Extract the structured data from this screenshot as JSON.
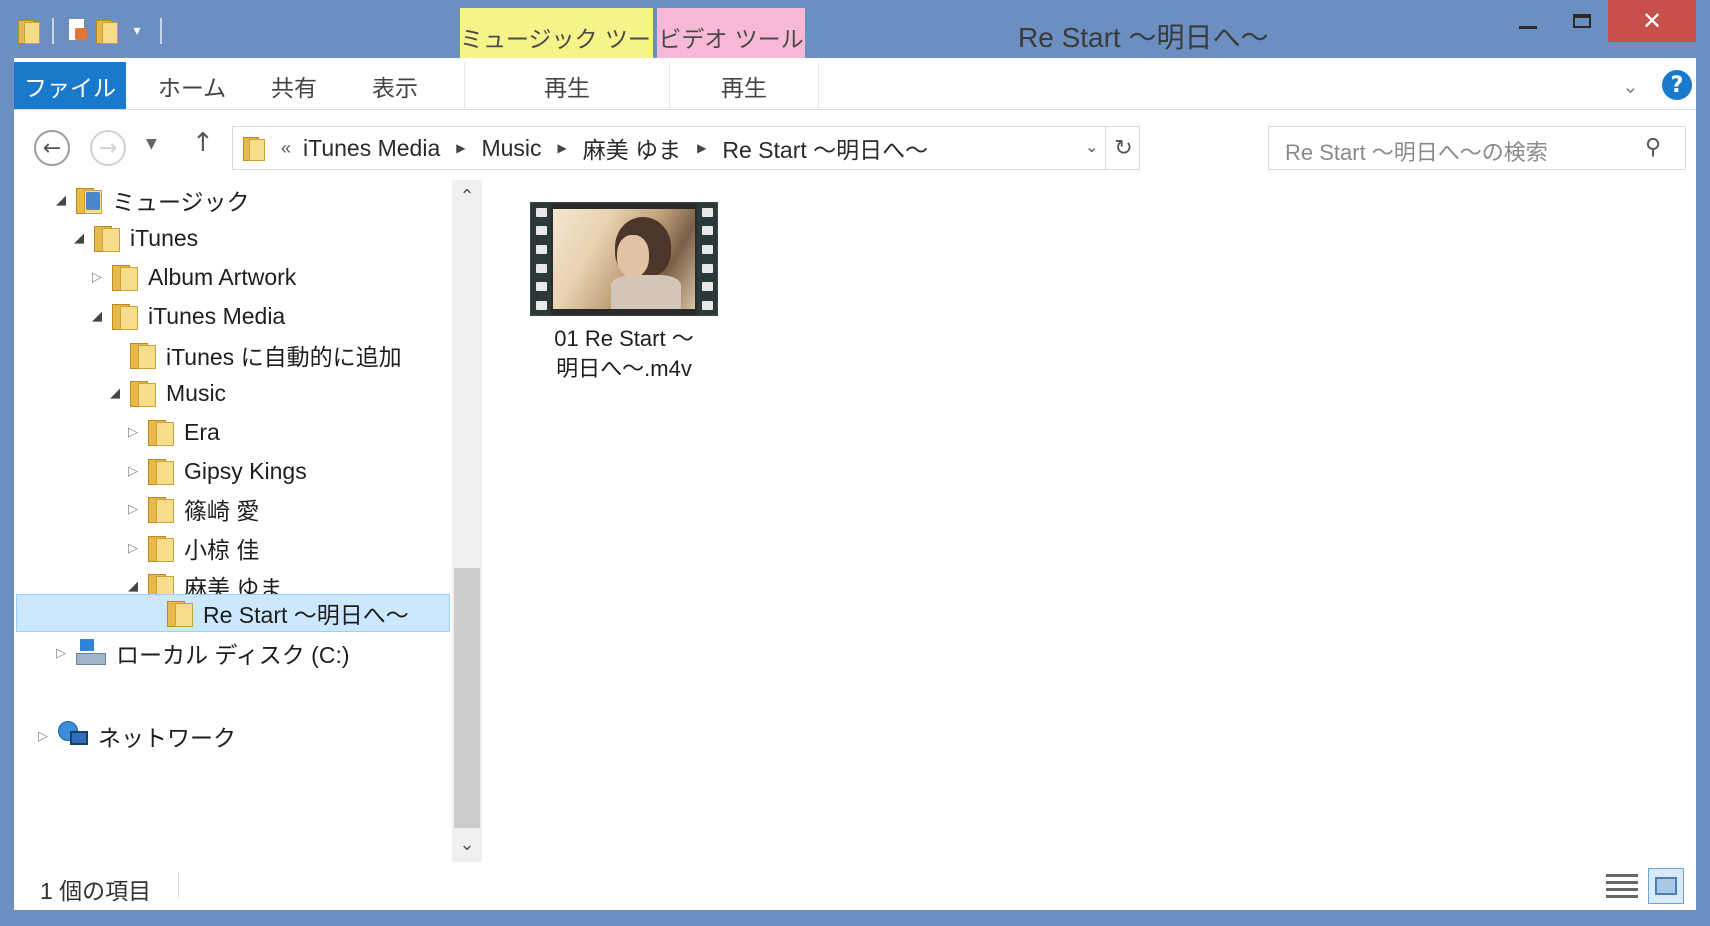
{
  "window": {
    "title": "Re Start ～明日へ～",
    "close_glyph": "✕"
  },
  "context_tabs": {
    "music_tools": "ミュージック ツール",
    "video_tools": "ビデオ ツール"
  },
  "ribbon": {
    "tabs": [
      "ファイル",
      "ホーム",
      "共有",
      "表示",
      "再生",
      "再生"
    ]
  },
  "address": {
    "lead": "«",
    "crumbs": [
      "iTunes Media",
      "Music",
      "麻美 ゆま",
      "Re Start ～明日へ～"
    ]
  },
  "search": {
    "placeholder": "Re Start ～明日へ～の検索"
  },
  "nav_tree": [
    {
      "label": "ミュージック",
      "expander": "◢",
      "indent": 0,
      "icon": "music-folder-icon"
    },
    {
      "label": "iTunes",
      "expander": "◢",
      "indent": 1,
      "icon": "folder-icon"
    },
    {
      "label": "Album Artwork",
      "expander": "▷",
      "indent": 2,
      "icon": "folder-icon"
    },
    {
      "label": "iTunes Media",
      "expander": "◢",
      "indent": 2,
      "icon": "folder-icon"
    },
    {
      "label": "iTunes に自動的に追加",
      "expander": "",
      "indent": 3,
      "icon": "folder-icon"
    },
    {
      "label": "Music",
      "expander": "◢",
      "indent": 3,
      "icon": "folder-icon"
    },
    {
      "label": "Era",
      "expander": "▷",
      "indent": 4,
      "icon": "folder-icon"
    },
    {
      "label": "Gipsy Kings",
      "expander": "▷",
      "indent": 4,
      "icon": "folder-icon"
    },
    {
      "label": "篠崎 愛",
      "expander": "▷",
      "indent": 4,
      "icon": "folder-icon"
    },
    {
      "label": "小椋 佳",
      "expander": "▷",
      "indent": 4,
      "icon": "folder-icon"
    },
    {
      "label": "麻美 ゆま",
      "expander": "◢",
      "indent": 4,
      "icon": "folder-icon"
    },
    {
      "label": "Re Start ～明日へ～",
      "expander": "",
      "indent": 5,
      "icon": "folder-icon",
      "selected": true
    },
    {
      "label": "ローカル ディスク (C:)",
      "expander": "▷",
      "indent": 0,
      "icon": "drive-icon"
    },
    {
      "label": "ネットワーク",
      "expander": "▷",
      "indent": -1,
      "icon": "network-icon"
    }
  ],
  "files": [
    {
      "name_line1": "01 Re Start ～",
      "name_line2": "明日へ～.m4v",
      "icon": "video-thumbnail"
    }
  ],
  "status": {
    "item_count": "1 個の項目"
  },
  "colors": {
    "frame": "#6b8fc0",
    "file_tab": "#1979ca",
    "music_tools": "#f5f38a",
    "video_tools": "#f7b9d6",
    "close": "#c7504a",
    "selection": "#cce8ff"
  }
}
